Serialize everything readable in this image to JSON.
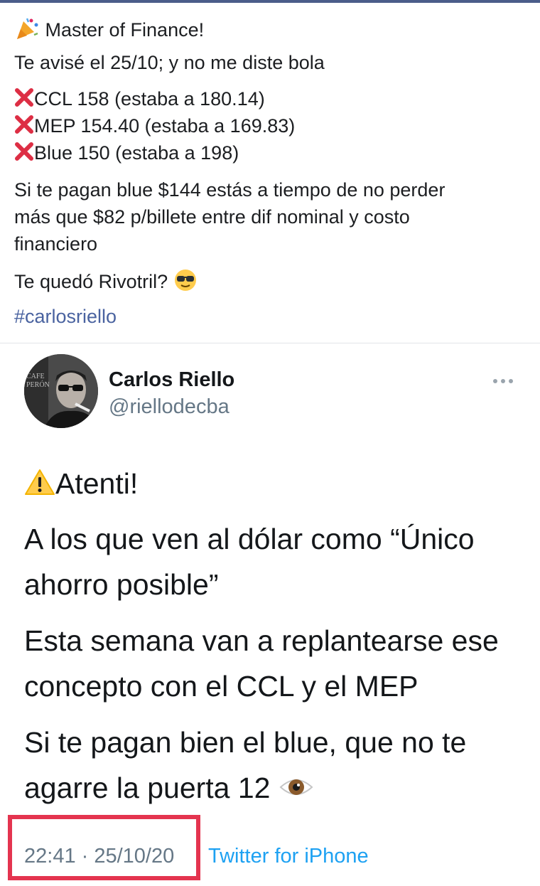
{
  "post": {
    "title": "Master of Finance!",
    "intro": "Te avisé el 25/10; y no me diste bola",
    "items": [
      "CCL 158 (estaba a 180.14)",
      "MEP 154.40 (estaba a 169.83)",
      "Blue 150 (estaba a 198)"
    ],
    "paragraph_line1": "Si te pagan blue $144 estás a tiempo de no perder",
    "paragraph_line2": "más que $82 p/billete entre dif nominal y costo",
    "paragraph_line3": "financiero",
    "question": "Te quedó Rivotril?",
    "hashtag": "#carlosriello"
  },
  "tweet": {
    "author_name": "Carlos Riello",
    "author_handle": "@riellodecba",
    "avatar_text": [
      "CAFE",
      "PERÓN"
    ],
    "heading": "Atenti!",
    "line1": "A los que ven al dólar como “Único",
    "line2": "ahorro posible”",
    "line3": "Esta semana van a replantearse ese",
    "line4": "concepto con el CCL y el MEP",
    "line5": "Si te pagan bien el blue, que no te",
    "line6": "agarre la puerta 12",
    "timestamp": "22:41 · 25/10/20",
    "source": "Twitter for iPhone"
  },
  "icons": {
    "title_emoji": "party-popper-icon",
    "cross": "cross-mark-icon",
    "question_emoji": "sunglasses-face-icon",
    "warning": "warning-icon",
    "eye": "eye-icon",
    "menu": "more-options-icon"
  },
  "colors": {
    "link": "#4a63a0",
    "twitter_blue": "#1da1f2",
    "cross": "#e0245e",
    "highlight": "#e4344f"
  }
}
